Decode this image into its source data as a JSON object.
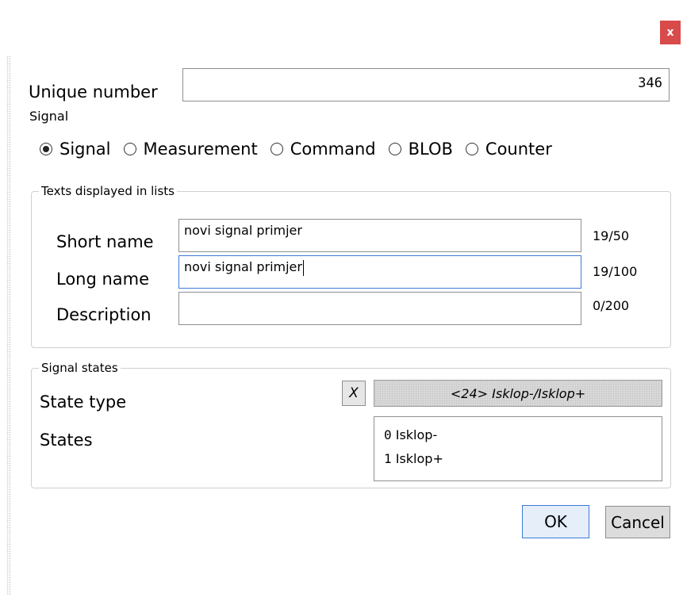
{
  "window": {
    "close_label": "x"
  },
  "unique_number": {
    "label": "Unique number",
    "value": "346"
  },
  "signal_type": {
    "group_label": "Signal",
    "options": [
      "Signal",
      "Measurement",
      "Command",
      "BLOB",
      "Counter"
    ],
    "selected": "Signal"
  },
  "texts_group": {
    "title": "Texts displayed in lists",
    "short_name": {
      "label": "Short name",
      "value": "novi signal primjer",
      "counter": "19/50"
    },
    "long_name": {
      "label": "Long name",
      "value": "novi signal primjer",
      "counter": "19/100"
    },
    "description": {
      "label": "Description",
      "value": "",
      "counter": "0/200"
    }
  },
  "signal_states": {
    "title": "Signal states",
    "state_type_label": "State type",
    "clear_label": "X",
    "state_type_value": "<24> Isklop-/Isklop+",
    "states_label": "States",
    "states": [
      {
        "num": "0",
        "name": "Isklop-"
      },
      {
        "num": "1",
        "name": "Isklop+"
      }
    ]
  },
  "buttons": {
    "ok": "OK",
    "cancel": "Cancel"
  },
  "colors": {
    "close_bg": "#d94a4a",
    "focus_border": "#3d7bd6"
  }
}
